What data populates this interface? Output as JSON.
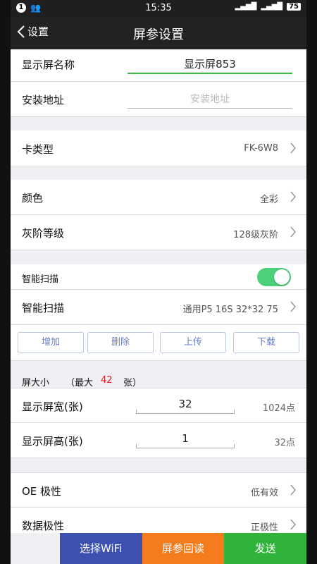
{
  "statusbar": {
    "notif_count": "1",
    "time": "15:35",
    "battery": "75"
  },
  "navbar": {
    "back_label": "设置",
    "title": "屏参设置"
  },
  "form": {
    "name_label": "显示屏名称",
    "name_value": "显示屏853",
    "address_label": "安装地址",
    "address_placeholder": "安装地址",
    "card_label": "卡类型",
    "card_value": "FK-6W8",
    "color_label": "颜色",
    "color_value": "全彩",
    "gray_label": "灰阶等级",
    "gray_value": "128级灰阶",
    "smart_section": "智能扫描",
    "smart_label": "智能扫描",
    "smart_value": "通用P5 16S 32*32 75",
    "buttons": {
      "add": "增加",
      "delete": "删除",
      "upload": "上传",
      "download": "下载"
    },
    "size_section_prefix": "屏大小",
    "size_section_max_prefix": "（最大",
    "size_max": "42",
    "size_section_suffix": "张）",
    "width_label": "显示屏宽(张)",
    "width_value": "32",
    "width_unit": "1024点",
    "height_label": "显示屏高(张)",
    "height_value": "1",
    "height_unit": "32点",
    "oe_label": "OE 极性",
    "oe_value": "低有效",
    "data_label": "数据极性",
    "data_value": "正极性"
  },
  "bottombar": {
    "wifi": "选择WiFi",
    "readback": "屏参回读",
    "send": "发送"
  },
  "colors": {
    "accent_green": "#3bb54a",
    "wifi_bg": "#3d51b1",
    "readback_bg": "#f57c1c",
    "send_bg": "#2fb33a",
    "max_red": "#e02020"
  }
}
